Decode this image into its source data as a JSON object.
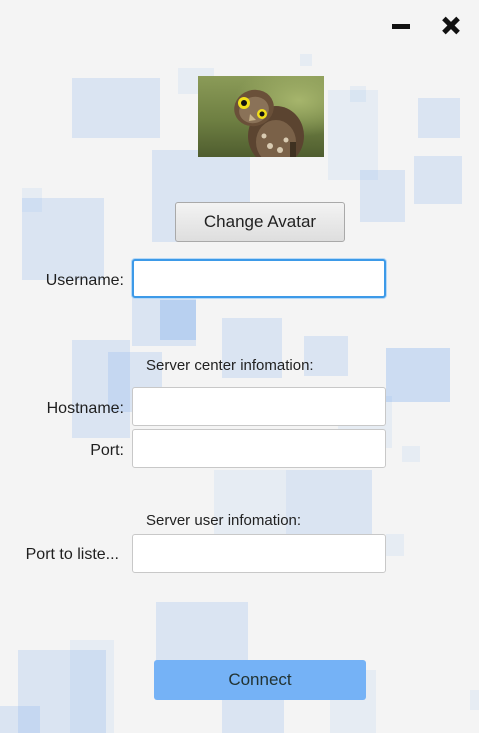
{
  "window_controls": {
    "minimize_icon": "minimize-icon",
    "close_icon": "close-icon"
  },
  "avatar": {
    "image": "owl-photo"
  },
  "buttons": {
    "change_avatar": "Change Avatar",
    "connect": "Connect"
  },
  "username": {
    "label": "Username:",
    "value": "",
    "placeholder": ""
  },
  "server_center": {
    "heading": "Server center infomation:",
    "hostname_label": "Hostname:",
    "hostname_value": "",
    "port_label": "Port:",
    "port_value": ""
  },
  "server_user": {
    "heading": "Server user infomation:",
    "listen_port_label": "Port to liste...",
    "listen_port_value": ""
  },
  "colors": {
    "accent": "#3d9ae8",
    "connect_button": "#75b2f6",
    "background": "#f4f4f4"
  }
}
